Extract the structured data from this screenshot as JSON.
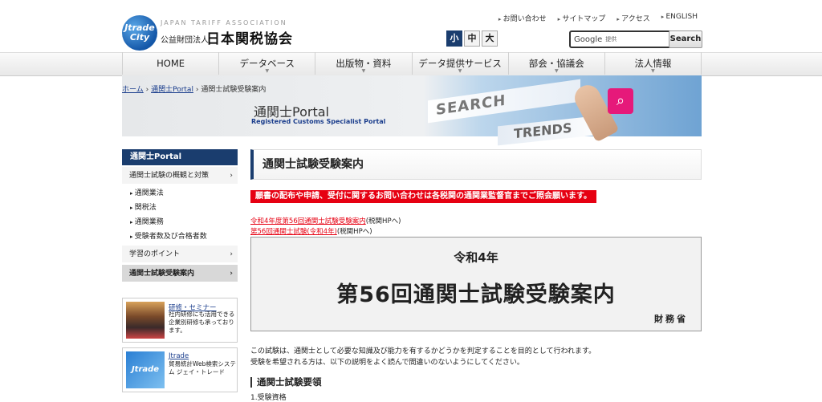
{
  "header": {
    "logo_line1": "Jtrade",
    "logo_line2": "City",
    "org_en": "JAPAN TARIFF ASSOCIATION",
    "org_ja_small": "公益財団法人",
    "org_ja": "日本関税協会",
    "top_links": [
      "お問い合わせ",
      "サイトマップ",
      "アクセス",
      "ENGLISH"
    ],
    "font_sizes": [
      "小",
      "中",
      "大"
    ],
    "search_brand": "Google",
    "search_placeholder": "提供",
    "search_button": "Search"
  },
  "nav": [
    "HOME",
    "データベース",
    "出版物・資料",
    "データ提供サービス",
    "部会・協議会",
    "法人情報"
  ],
  "hero": {
    "breadcrumb": [
      "ホーム",
      "通関士Portal",
      "通関士試験受験案内"
    ],
    "title": "通関士Portal",
    "subtitle": "Registered Customs Specialist Portal",
    "img_search": "SEARCH",
    "img_trends": "TRENDS"
  },
  "sidebar": {
    "title": "通関士Portal",
    "item1": "通関士試験の概観と対策",
    "subs": [
      "通関業法",
      "関税法",
      "通関業務",
      "受験者数及び合格者数"
    ],
    "item2": "学習のポイント",
    "item3": "通関士試験受験案内",
    "banners": [
      {
        "title": "研修・セミナー",
        "desc": "社内研修にも活用できる企業別研修も承っております。"
      },
      {
        "title": "Jtrade",
        "desc": "貿易統計Web検索システム ジェイ・トレード",
        "thumb_text": "Jtrade"
      }
    ]
  },
  "main": {
    "heading": "通関士試験受験案内",
    "notice": "願書の配布や申請、受付に関するお問い合わせは各税関の通関業監督官までご照会願います。",
    "links": [
      {
        "link": "令和4年度第56回通関士試験受験案内",
        "suffix": "(税関HPへ)"
      },
      {
        "link": "第56回通関士試験(令和4年)",
        "suffix": "(税関HPへ)"
      }
    ],
    "box_year": "令和4年",
    "box_title": "第56回通関士試験受験案内",
    "box_ministry": "財務省",
    "para1": "この試験は、通関士として必要な知識及び能力を有するかどうかを判定することを目的として行われます。",
    "para2": "受験を希望される方は、以下の説明をよく読んで間違いのないようにしてください。",
    "section_head": "通関士試験要領",
    "section_sub": "1.受験資格"
  },
  "colors": {
    "navy": "#1a3d6e",
    "red": "#e60012",
    "link_blue": "#1a3d8c"
  }
}
